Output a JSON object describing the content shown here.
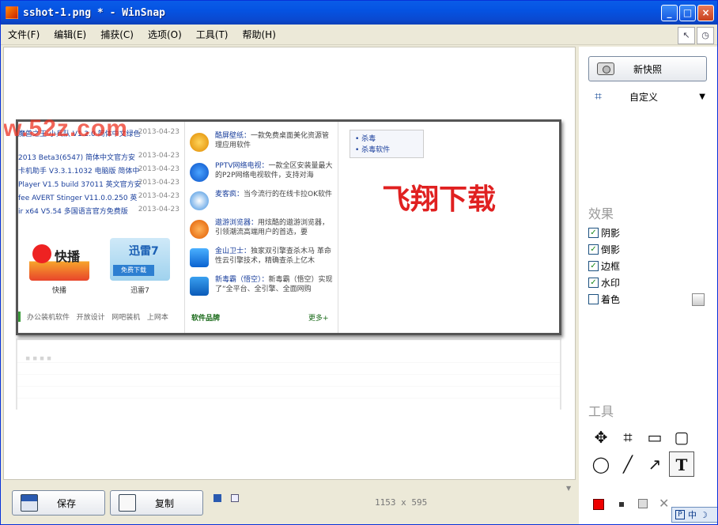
{
  "window": {
    "title": "sshot-1.png * - WinSnap",
    "controls": [
      "_",
      "□",
      "×"
    ]
  },
  "menu": [
    "文件(F)",
    "编辑(E)",
    "捕获(C)",
    "选项(O)",
    "工具(T)",
    "帮助(H)"
  ],
  "menu_right": [
    "↖",
    "◷"
  ],
  "screenshot": {
    "site_watermark": "w.52z.com",
    "big_text": "飞翔下载",
    "downloads": [
      {
        "name": "魔兽之王·小兵队 V1.2.0 简体中文绿色",
        "date": "2013-04-23"
      },
      {
        "name": "2013 Beta3(6547) 简体中文官方安",
        "date": "2013-04-23"
      },
      {
        "name": "卡机助手 V3.3.1.1032 电脑版 简体中",
        "date": "2013-04-23"
      },
      {
        "name": "Player V1.5 build 37011 英文官方安",
        "date": "2013-04-23"
      },
      {
        "name": "fee AVERT Stinger V11.0.0.250 英",
        "date": "2013-04-23"
      },
      {
        "name": "ir x64 V5.54 多国语言官方免费版",
        "date": "2013-04-23"
      }
    ],
    "software": [
      {
        "name": "酷屏壁纸：",
        "desc": "一款免费桌面美化资源管理应用软件"
      },
      {
        "name": "PPTV网络电视：",
        "desc": "一款全区安装量最大的P2P网络电视软件，支持对海"
      },
      {
        "name": "麦客疯：",
        "desc": "当今流行的在线卡拉OK软件"
      },
      {
        "name": "遨游浏览器：",
        "desc": "用炫酷的遨游浏览器，引领潮流高端用户的首选，要"
      },
      {
        "name": "金山卫士：",
        "desc": "独家双引擎查杀木马 革命性云引擎技术，精确查杀上亿木"
      },
      {
        "name": "新毒霸（悟空）：",
        "desc": "新毒霸（悟空）实现了“全平台、全引擎、全面网购"
      }
    ],
    "logos": [
      {
        "name": "快播",
        "caption": "快播"
      },
      {
        "name": "迅雷7",
        "caption": "迅雷7",
        "sub": "免费下载"
      }
    ],
    "tabs": [
      "办公装机软件",
      "开放设计",
      "网吧装机",
      "上网本"
    ],
    "brand": "软件品牌",
    "more": "更多+",
    "box_links": [
      "• 杀毒",
      "• 杀毒软件"
    ]
  },
  "right_panel": {
    "new_snapshot": "新快照",
    "mode": "自定义",
    "effects_title": "效果",
    "effects": [
      {
        "label": "阴影",
        "checked": true
      },
      {
        "label": "倒影",
        "checked": true
      },
      {
        "label": "边框",
        "checked": true
      },
      {
        "label": "水印",
        "checked": true
      },
      {
        "label": "着色",
        "checked": false
      }
    ],
    "tools_title": "工具",
    "tools": [
      "✥",
      "⌗",
      "▭",
      "▢",
      "◯",
      "╱",
      "↗",
      "T"
    ]
  },
  "bottom": {
    "save": "保存",
    "copy": "复制",
    "size": "1153 x 595"
  },
  "tray": {
    "ime": "中",
    "ime_extra": "☽"
  },
  "colors": {
    "accent": "#0a5ce8",
    "draw_color": "#ee0000"
  }
}
